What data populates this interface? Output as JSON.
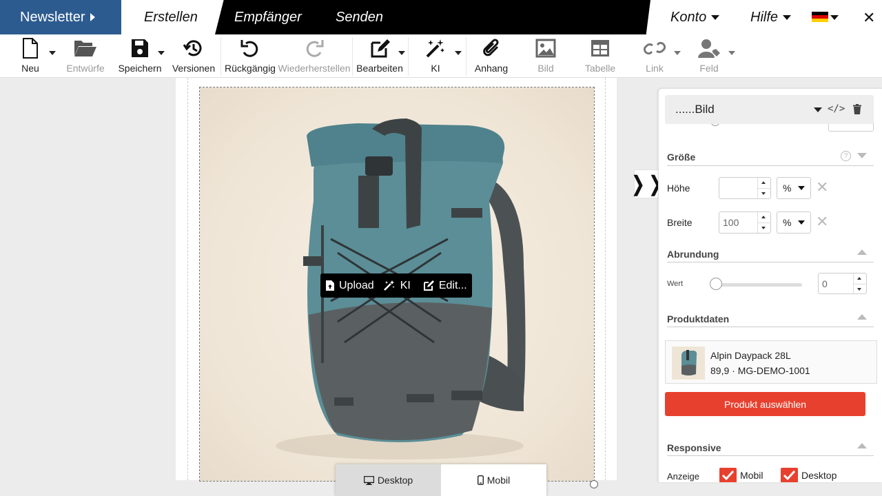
{
  "nav": {
    "brand": "Newsletter",
    "tabs": [
      "Erstellen",
      "Empfänger",
      "Senden"
    ],
    "account": "Konto",
    "help": "Hilfe"
  },
  "toolbar": {
    "new": "Neu",
    "drafts": "Entwürfe",
    "save": "Speichern",
    "versions": "Versionen",
    "undo": "Rückgängig",
    "redo": "Wiederherstellen",
    "edit": "Bearbeiten",
    "ai": "KI",
    "attachment": "Anhang",
    "image": "Bild",
    "table": "Tabelle",
    "link": "Link",
    "field": "Feld"
  },
  "image_toolbar": {
    "upload": "Upload",
    "ai": "KI",
    "edit": "Edit..."
  },
  "device": {
    "desktop": "Desktop",
    "mobile": "Mobil"
  },
  "panel": {
    "title": "......Bild",
    "size": {
      "title": "Größe",
      "height_label": "Höhe",
      "height_value": "",
      "height_unit": "%",
      "width_label": "Breite",
      "width_value": "100",
      "width_unit": "%"
    },
    "rounding": {
      "title": "Abrundung",
      "value_label": "Wert",
      "value": "0"
    },
    "product": {
      "title": "Produktdaten",
      "name": "Alpin Daypack 28L",
      "meta": "89,9 · MG-DEMO-1001",
      "select_button": "Produkt auswählen"
    },
    "responsive": {
      "title": "Responsive",
      "display_label": "Anzeige",
      "mobile": "Mobil",
      "desktop": "Desktop"
    }
  },
  "colors": {
    "brand": "#2c5b8f",
    "accent": "#e8402e",
    "backpack_teal": "#5b8e97",
    "backpack_gray": "#5a6062"
  }
}
